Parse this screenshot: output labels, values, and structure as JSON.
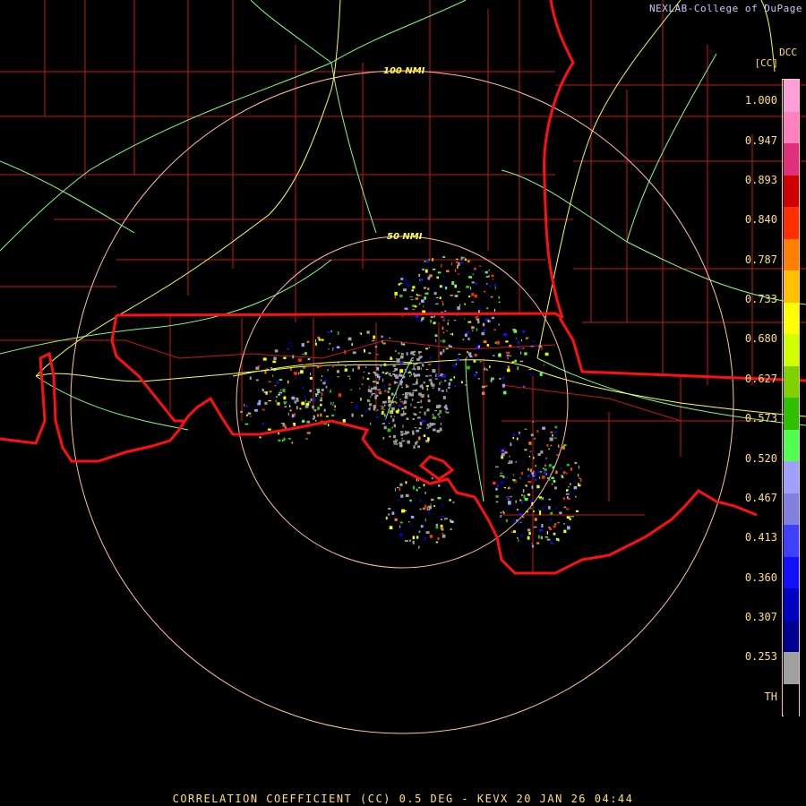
{
  "credit": "NEXLAB-College of DuPage",
  "product_code": "DCC",
  "units": "[CC]",
  "title": "CORRELATION COEFFICIENT (CC) 0.5 DEG - KEVX 20 JAN 26 04:44",
  "range_rings": [
    "100 NMI",
    "50 NMI"
  ],
  "legend": {
    "ticks": [
      "1.000",
      "0.947",
      "0.893",
      "0.840",
      "0.787",
      "0.733",
      "0.680",
      "0.627",
      "0.573",
      "0.520",
      "0.467",
      "0.413",
      "0.360",
      "0.307",
      "0.253",
      "TH"
    ],
    "colors": [
      "#ff9fd7",
      "#ff80bf",
      "#e0307a",
      "#d00000",
      "#ff3000",
      "#ff8000",
      "#ffc000",
      "#ffff00",
      "#d0ff00",
      "#80d000",
      "#30c000",
      "#50ff50",
      "#a0a0ff",
      "#8080e0",
      "#4040ff",
      "#1010ff",
      "#0000c0",
      "#000090",
      "#a0a0a0",
      "#000000"
    ]
  },
  "map_colors": {
    "state_border": "#ff1010",
    "county_border": "#c81818",
    "highway_yellow": "#ffff40",
    "highway_green": "#80ff80",
    "range_ring": "#ffc0a0"
  }
}
